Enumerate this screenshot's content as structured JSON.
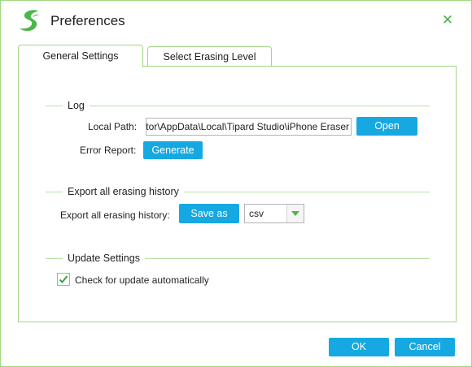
{
  "window": {
    "title": "Preferences",
    "accent_color": "#16a8e1",
    "border_color": "#9fd67f",
    "icons": {
      "logo": "tipard-logo-icon",
      "close": "close-icon"
    }
  },
  "tabs": [
    {
      "label": "General Settings",
      "active": true
    },
    {
      "label": "Select Erasing Level",
      "active": false
    }
  ],
  "log": {
    "section_title": "Log",
    "local_path_label": "Local Path:",
    "local_path_value": "C:\\Users\\Administrator\\AppData\\Local\\Tipard Studio\\iPhone Eraser",
    "open_label": "Open",
    "error_report_label": "Error Report:",
    "generate_label": "Generate"
  },
  "export": {
    "section_title": "Export all erasing history",
    "row_label": "Export all erasing history:",
    "save_as_label": "Save as",
    "format_value": "csv"
  },
  "update": {
    "section_title": "Update Settings",
    "auto_update_label": "Check for update automatically",
    "auto_update_checked": true
  },
  "footer": {
    "ok_label": "OK",
    "cancel_label": "Cancel"
  }
}
